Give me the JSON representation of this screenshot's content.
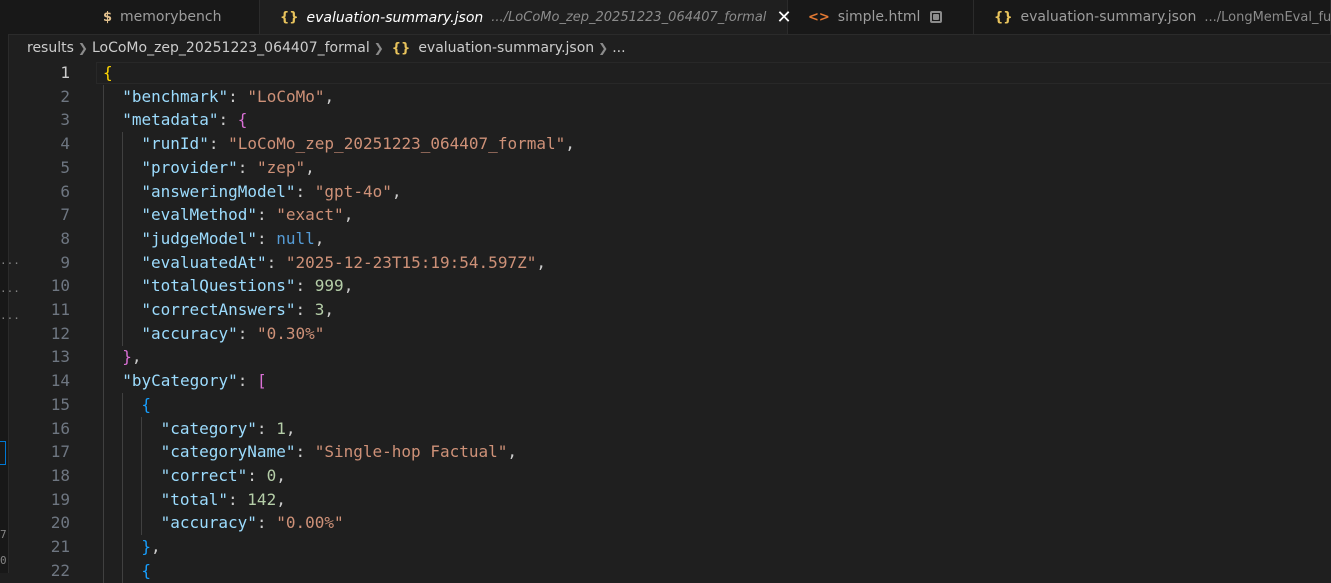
{
  "tabs": [
    {
      "icon": "$",
      "name": "memorybench",
      "description": "",
      "active": false,
      "italic": false,
      "state": "none"
    },
    {
      "icon": "{}",
      "name": "evaluation-summary.json",
      "description": ".../LoCoMo_zep_20251223_064407_formal",
      "active": true,
      "italic": true,
      "state": "close"
    },
    {
      "icon": "<>",
      "name": "simple.html",
      "description": "",
      "active": false,
      "italic": false,
      "state": "dirty"
    },
    {
      "icon": "{}",
      "name": "evaluation-summary.json",
      "description": ".../LongMemEval_full",
      "active": false,
      "italic": false,
      "state": "none"
    }
  ],
  "breadcrumb": {
    "folder1": "results",
    "folder2": "LoCoMo_zep_20251223_064407_formal",
    "file": "evaluation-summary.json",
    "more": "..."
  },
  "left_panel_marks": [
    "...",
    "...",
    "...",
    "7",
    "0"
  ],
  "editor": {
    "current_line": 1,
    "lines": [
      {
        "n": 1,
        "indent": 0,
        "tokens": [
          {
            "t": "b1",
            "v": "{"
          }
        ]
      },
      {
        "n": 2,
        "indent": 1,
        "tokens": [
          {
            "t": "k",
            "v": "\"benchmark\""
          },
          {
            "t": "p",
            "v": ": "
          },
          {
            "t": "s",
            "v": "\"LoCoMo\""
          },
          {
            "t": "p",
            "v": ","
          }
        ]
      },
      {
        "n": 3,
        "indent": 1,
        "tokens": [
          {
            "t": "k",
            "v": "\"metadata\""
          },
          {
            "t": "p",
            "v": ": "
          },
          {
            "t": "b2",
            "v": "{"
          }
        ]
      },
      {
        "n": 4,
        "indent": 2,
        "tokens": [
          {
            "t": "k",
            "v": "\"runId\""
          },
          {
            "t": "p",
            "v": ": "
          },
          {
            "t": "s",
            "v": "\"LoCoMo_zep_20251223_064407_formal\""
          },
          {
            "t": "p",
            "v": ","
          }
        ]
      },
      {
        "n": 5,
        "indent": 2,
        "tokens": [
          {
            "t": "k",
            "v": "\"provider\""
          },
          {
            "t": "p",
            "v": ": "
          },
          {
            "t": "s",
            "v": "\"zep\""
          },
          {
            "t": "p",
            "v": ","
          }
        ]
      },
      {
        "n": 6,
        "indent": 2,
        "tokens": [
          {
            "t": "k",
            "v": "\"answeringModel\""
          },
          {
            "t": "p",
            "v": ": "
          },
          {
            "t": "s",
            "v": "\"gpt-4o\""
          },
          {
            "t": "p",
            "v": ","
          }
        ]
      },
      {
        "n": 7,
        "indent": 2,
        "tokens": [
          {
            "t": "k",
            "v": "\"evalMethod\""
          },
          {
            "t": "p",
            "v": ": "
          },
          {
            "t": "s",
            "v": "\"exact\""
          },
          {
            "t": "p",
            "v": ","
          }
        ]
      },
      {
        "n": 8,
        "indent": 2,
        "tokens": [
          {
            "t": "k",
            "v": "\"judgeModel\""
          },
          {
            "t": "p",
            "v": ": "
          },
          {
            "t": "kw",
            "v": "null"
          },
          {
            "t": "p",
            "v": ","
          }
        ]
      },
      {
        "n": 9,
        "indent": 2,
        "tokens": [
          {
            "t": "k",
            "v": "\"evaluatedAt\""
          },
          {
            "t": "p",
            "v": ": "
          },
          {
            "t": "s",
            "v": "\"2025-12-23T15:19:54.597Z\""
          },
          {
            "t": "p",
            "v": ","
          }
        ]
      },
      {
        "n": 10,
        "indent": 2,
        "tokens": [
          {
            "t": "k",
            "v": "\"totalQuestions\""
          },
          {
            "t": "p",
            "v": ": "
          },
          {
            "t": "n",
            "v": "999"
          },
          {
            "t": "p",
            "v": ","
          }
        ]
      },
      {
        "n": 11,
        "indent": 2,
        "tokens": [
          {
            "t": "k",
            "v": "\"correctAnswers\""
          },
          {
            "t": "p",
            "v": ": "
          },
          {
            "t": "n",
            "v": "3"
          },
          {
            "t": "p",
            "v": ","
          }
        ]
      },
      {
        "n": 12,
        "indent": 2,
        "tokens": [
          {
            "t": "k",
            "v": "\"accuracy\""
          },
          {
            "t": "p",
            "v": ": "
          },
          {
            "t": "s",
            "v": "\"0.30%\""
          }
        ]
      },
      {
        "n": 13,
        "indent": 1,
        "tokens": [
          {
            "t": "b2",
            "v": "}"
          },
          {
            "t": "p",
            "v": ","
          }
        ]
      },
      {
        "n": 14,
        "indent": 1,
        "tokens": [
          {
            "t": "k",
            "v": "\"byCategory\""
          },
          {
            "t": "p",
            "v": ": "
          },
          {
            "t": "b2",
            "v": "["
          }
        ]
      },
      {
        "n": 15,
        "indent": 2,
        "tokens": [
          {
            "t": "b3",
            "v": "{"
          }
        ]
      },
      {
        "n": 16,
        "indent": 3,
        "tokens": [
          {
            "t": "k",
            "v": "\"category\""
          },
          {
            "t": "p",
            "v": ": "
          },
          {
            "t": "n",
            "v": "1"
          },
          {
            "t": "p",
            "v": ","
          }
        ]
      },
      {
        "n": 17,
        "indent": 3,
        "tokens": [
          {
            "t": "k",
            "v": "\"categoryName\""
          },
          {
            "t": "p",
            "v": ": "
          },
          {
            "t": "s",
            "v": "\"Single-hop Factual\""
          },
          {
            "t": "p",
            "v": ","
          }
        ]
      },
      {
        "n": 18,
        "indent": 3,
        "tokens": [
          {
            "t": "k",
            "v": "\"correct\""
          },
          {
            "t": "p",
            "v": ": "
          },
          {
            "t": "n",
            "v": "0"
          },
          {
            "t": "p",
            "v": ","
          }
        ]
      },
      {
        "n": 19,
        "indent": 3,
        "tokens": [
          {
            "t": "k",
            "v": "\"total\""
          },
          {
            "t": "p",
            "v": ": "
          },
          {
            "t": "n",
            "v": "142"
          },
          {
            "t": "p",
            "v": ","
          }
        ]
      },
      {
        "n": 20,
        "indent": 3,
        "tokens": [
          {
            "t": "k",
            "v": "\"accuracy\""
          },
          {
            "t": "p",
            "v": ": "
          },
          {
            "t": "s",
            "v": "\"0.00%\""
          }
        ]
      },
      {
        "n": 21,
        "indent": 2,
        "tokens": [
          {
            "t": "b3",
            "v": "}"
          },
          {
            "t": "p",
            "v": ","
          }
        ]
      },
      {
        "n": 22,
        "indent": 2,
        "tokens": [
          {
            "t": "b3",
            "v": "{"
          }
        ]
      }
    ]
  }
}
